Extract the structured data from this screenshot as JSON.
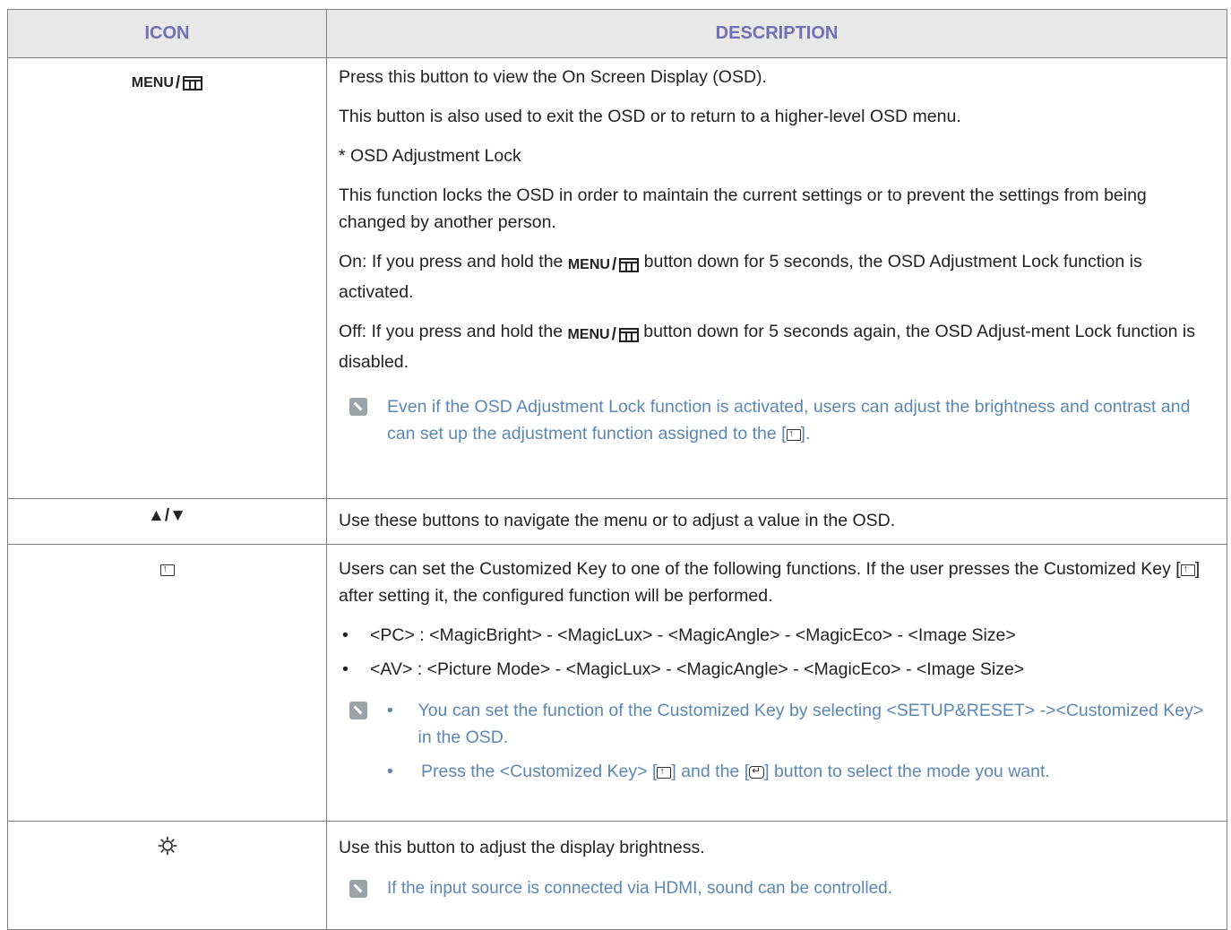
{
  "header": {
    "icon": "ICON",
    "description": "DESCRIPTION"
  },
  "rows": {
    "menu": {
      "icon": "menu-icon",
      "menu_word": "MENU",
      "p1": "Press this button to view the On Screen Display (OSD).",
      "p2": "This button is also used to exit the OSD or to return to a higher-level OSD menu.",
      "p3": "* OSD Adjustment Lock",
      "p4": "This function locks the OSD in order to maintain the current settings or to prevent the settings from being changed by another person.",
      "on_pre": "On: If you press and hold the",
      "on_post": "button down for 5 seconds, the OSD Adjustment Lock function is activated.",
      "off_pre": "Off: If you press and hold the",
      "off_post": "button down for 5 seconds again, the OSD Adjust-ment Lock function is disabled.",
      "note_pre": "Even if the OSD Adjustment Lock function is activated, users can adjust the brightness and contrast and can set up the adjustment function assigned to the [",
      "note_post": "]."
    },
    "updown": {
      "icon_text": "▲/▼",
      "text": "Use these buttons to navigate the menu or to adjust a value in the OSD."
    },
    "custom": {
      "icon": "customized-key-icon",
      "intro_pre": "Users can set the Customized Key to one of the following functions. If the user presses the Customized Key [",
      "intro_post": "] after setting it, the configured function will be performed.",
      "bullets": [
        "<PC> : <MagicBright> - <MagicLux> - <MagicAngle> - <MagicEco> - <Image Size>",
        "<AV> : <Picture Mode> - <MagicLux> - <MagicAngle> - <MagicEco> - <Image Size>"
      ],
      "note1": "You can set the function of the Customized Key by selecting <SETUP&RESET> -><Customized Key> in the OSD.",
      "note2_pre": "Press the <Customized Key> [",
      "note2_mid": "] and the [",
      "note2_post": "] button to select the mode you want."
    },
    "brightness": {
      "icon": "sun-icon",
      "text": "Use this button to adjust the display brightness.",
      "note": "If the input source is connected via HDMI, sound can be controlled."
    }
  },
  "bullet_char": "•"
}
